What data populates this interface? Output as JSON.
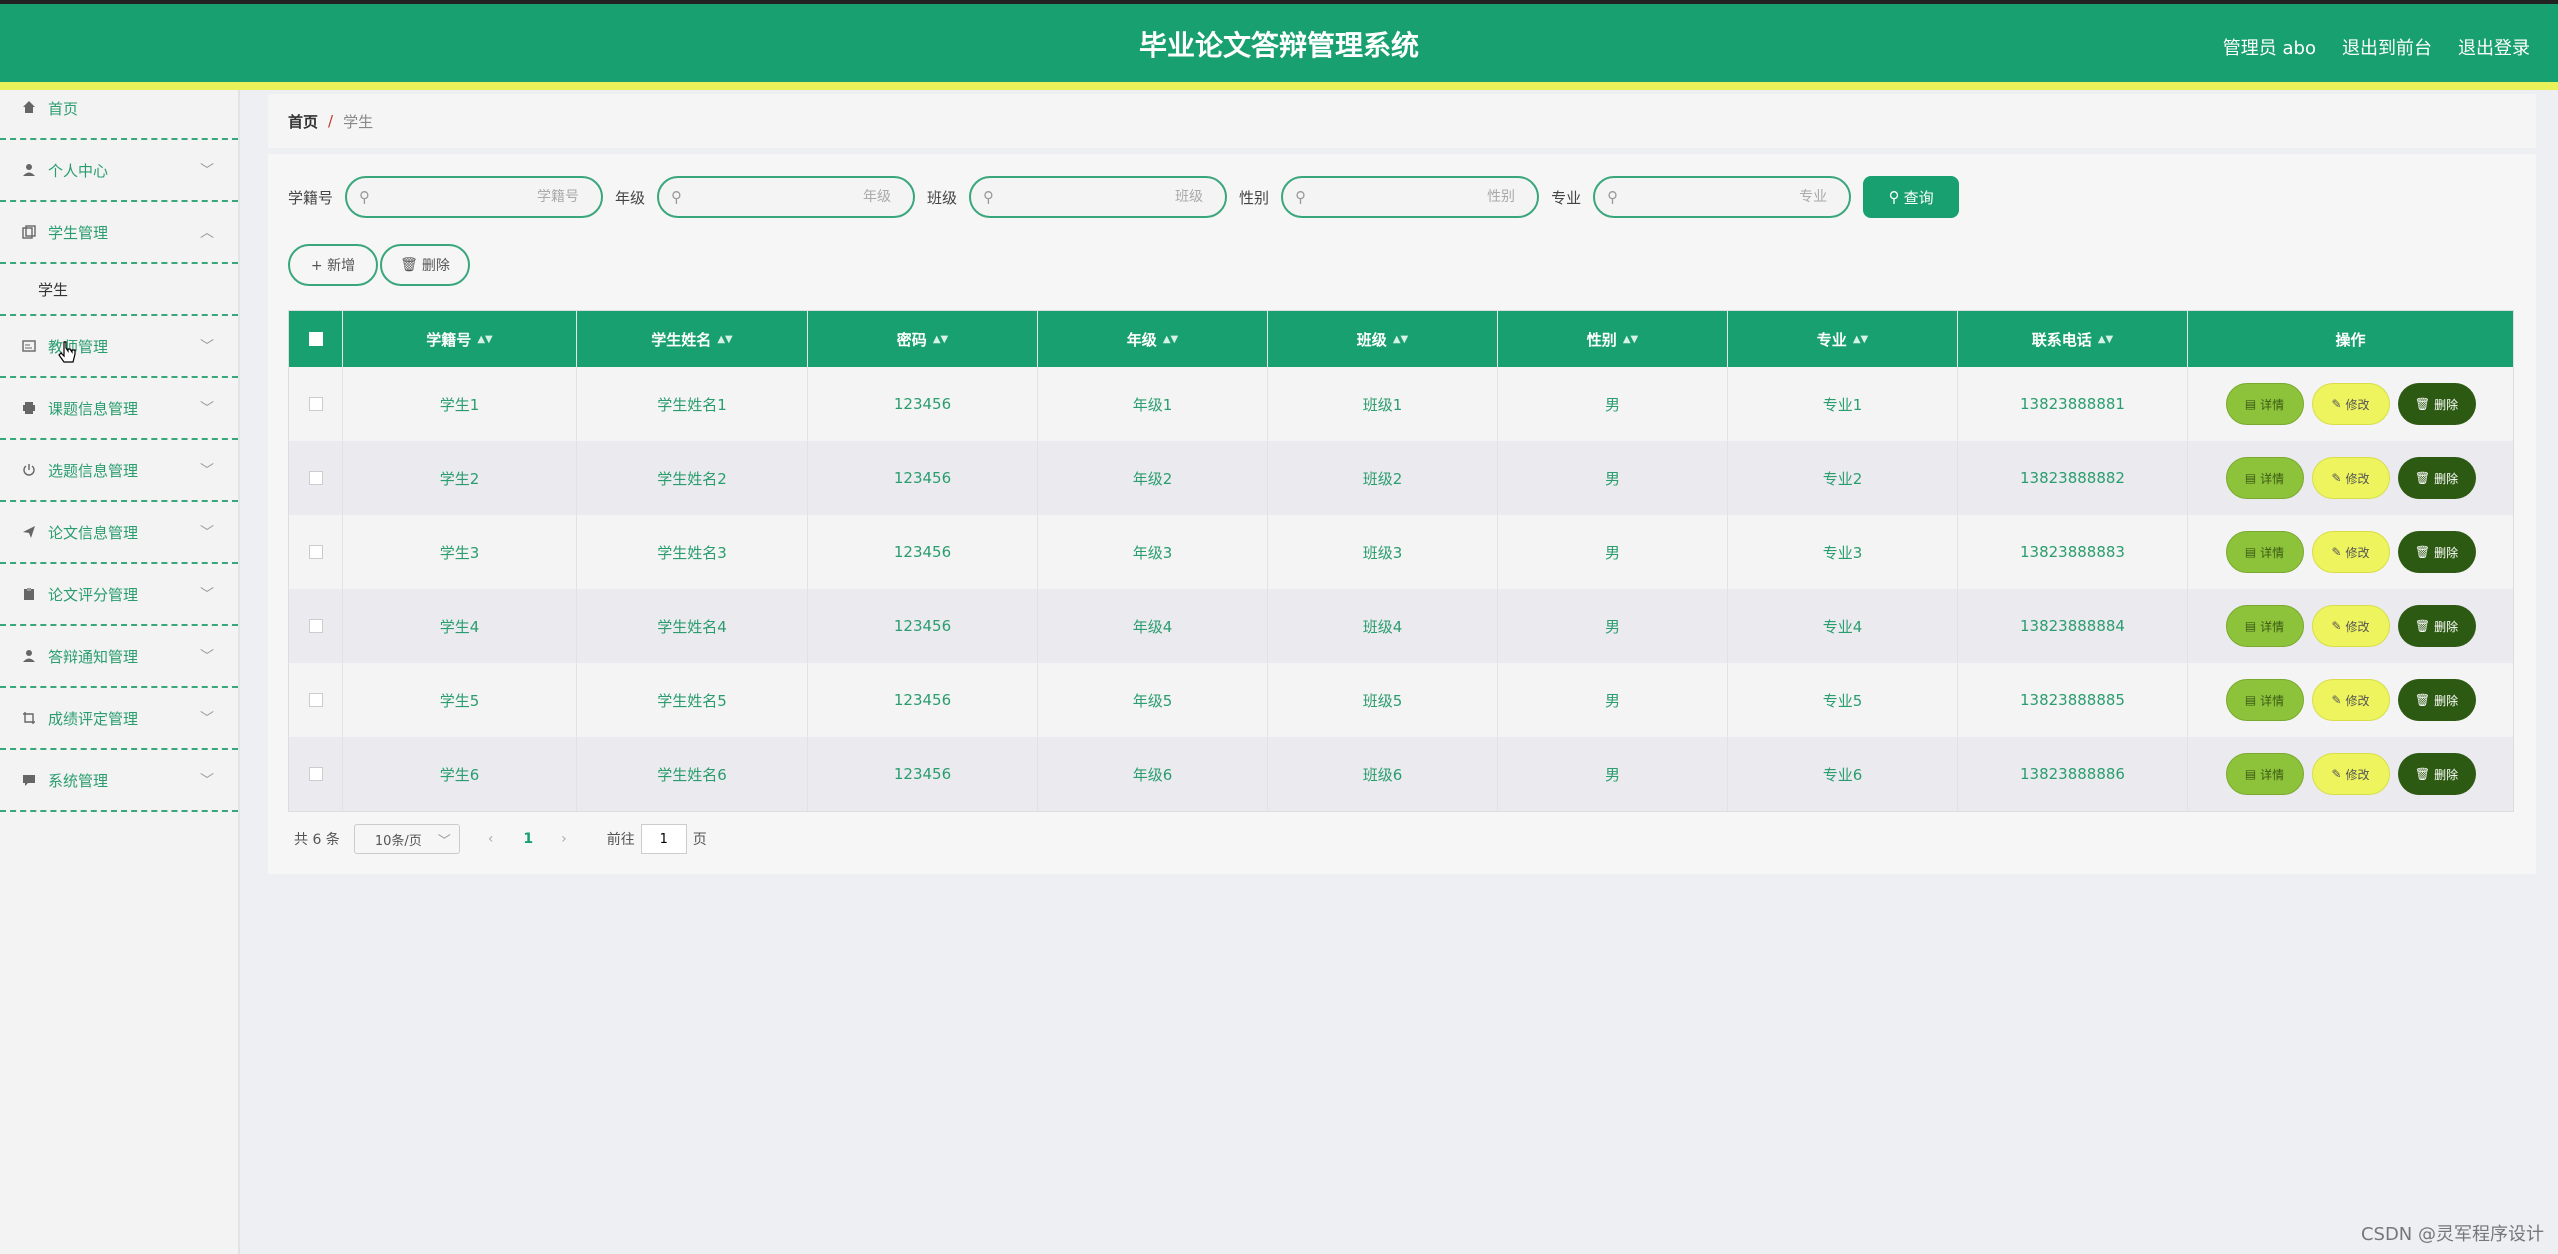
{
  "header": {
    "title": "毕业论文答辩管理系统",
    "admin": "管理员 abo",
    "to_front": "退出到前台",
    "logout": "退出登录"
  },
  "sidebar": {
    "items": [
      {
        "label": "首页",
        "icon": "home-icon"
      },
      {
        "label": "个人中心",
        "icon": "user-icon"
      },
      {
        "label": "学生管理",
        "icon": "copy-icon"
      },
      {
        "label": "教师管理",
        "icon": "card-icon"
      },
      {
        "label": "课题信息管理",
        "icon": "printer-icon"
      },
      {
        "label": "选题信息管理",
        "icon": "power-icon"
      },
      {
        "label": "论文信息管理",
        "icon": "send-icon"
      },
      {
        "label": "论文评分管理",
        "icon": "clipboard-icon"
      },
      {
        "label": "答辩通知管理",
        "icon": "user-icon"
      },
      {
        "label": "成绩评定管理",
        "icon": "crop-icon"
      },
      {
        "label": "系统管理",
        "icon": "chat-icon"
      }
    ],
    "subitem": "学生"
  },
  "breadcrumb": {
    "home": "首页",
    "sep": "/",
    "current": "学生"
  },
  "search": {
    "fields": [
      {
        "label": "学籍号",
        "placeholder": "学籍号"
      },
      {
        "label": "年级",
        "placeholder": "年级"
      },
      {
        "label": "班级",
        "placeholder": "班级"
      },
      {
        "label": "性别",
        "placeholder": "性别"
      },
      {
        "label": "专业",
        "placeholder": "专业"
      }
    ],
    "query_label": "查询"
  },
  "actions": {
    "add": "+ 新增",
    "delete": "删除"
  },
  "table": {
    "headers": [
      "学籍号",
      "学生姓名",
      "密码",
      "年级",
      "班级",
      "性别",
      "专业",
      "联系电话",
      "操作"
    ],
    "rows": [
      [
        "学生1",
        "学生姓名1",
        "123456",
        "年级1",
        "班级1",
        "男",
        "专业1",
        "13823888881"
      ],
      [
        "学生2",
        "学生姓名2",
        "123456",
        "年级2",
        "班级2",
        "男",
        "专业2",
        "13823888882"
      ],
      [
        "学生3",
        "学生姓名3",
        "123456",
        "年级3",
        "班级3",
        "男",
        "专业3",
        "13823888883"
      ],
      [
        "学生4",
        "学生姓名4",
        "123456",
        "年级4",
        "班级4",
        "男",
        "专业4",
        "13823888884"
      ],
      [
        "学生5",
        "学生姓名5",
        "123456",
        "年级5",
        "班级5",
        "男",
        "专业5",
        "13823888885"
      ],
      [
        "学生6",
        "学生姓名6",
        "123456",
        "年级6",
        "班级6",
        "男",
        "专业6",
        "13823888886"
      ]
    ],
    "op_labels": {
      "detail": "详情",
      "edit": "修改",
      "remove": "删除"
    }
  },
  "pager": {
    "total": "共 6 条",
    "page_size": "10条/页",
    "current_page": "1",
    "goto_label": "前往",
    "goto_value": "1",
    "page_unit": "页"
  },
  "watermark": "CSDN @灵军程序设计",
  "colors": {
    "primary": "#18a070",
    "stripe": "#eaf25a",
    "detail": "#8dc33a",
    "edit": "#eef45d",
    "remove": "#2d5a12"
  }
}
